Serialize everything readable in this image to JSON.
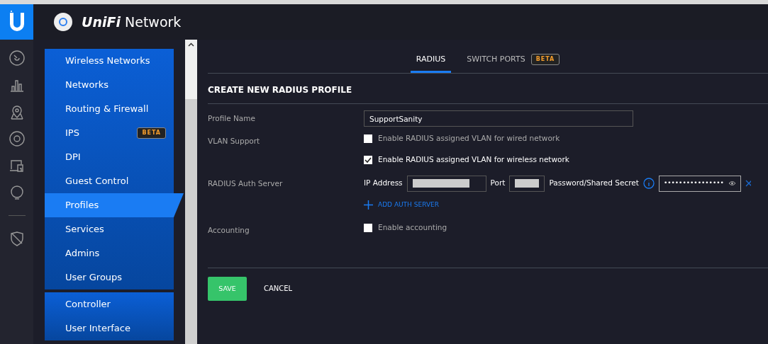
{
  "header": {
    "brand_italic": "UniFi",
    "brand": "Network"
  },
  "rail": [
    {
      "kind": "dashboard"
    },
    {
      "kind": "stats"
    },
    {
      "kind": "map"
    },
    {
      "kind": "devices"
    },
    {
      "kind": "clients"
    },
    {
      "kind": "insights"
    },
    {
      "kind": "divider"
    },
    {
      "kind": "shield"
    }
  ],
  "sidebar": {
    "groups": [
      {
        "items": [
          {
            "label": "Wireless Networks",
            "selected": false
          },
          {
            "label": "Networks",
            "selected": false
          },
          {
            "label": "Routing & Firewall",
            "selected": false
          },
          {
            "label": "IPS",
            "selected": false,
            "badge": "BETA"
          },
          {
            "label": "DPI",
            "selected": false
          },
          {
            "label": "Guest Control",
            "selected": false
          },
          {
            "label": "Profiles",
            "selected": true
          },
          {
            "label": "Services",
            "selected": false
          },
          {
            "label": "Admins",
            "selected": false
          },
          {
            "label": "User Groups",
            "selected": false
          }
        ]
      },
      {
        "items": [
          {
            "label": "Controller",
            "selected": false
          },
          {
            "label": "User Interface",
            "selected": false
          }
        ]
      }
    ]
  },
  "tabs": [
    {
      "label": "RADIUS",
      "selected": true
    },
    {
      "label": "SWITCH PORTS",
      "selected": false,
      "badge": "BETA"
    }
  ],
  "form": {
    "title": "CREATE NEW RADIUS PROFILE",
    "profile_name": {
      "label": "Profile Name",
      "value": "SupportSanity"
    },
    "vlan": {
      "label": "VLAN Support",
      "options": [
        {
          "label": "Enable RADIUS assigned VLAN for wired network",
          "checked": false
        },
        {
          "label": "Enable RADIUS assigned VLAN for wireless network",
          "checked": true
        }
      ]
    },
    "auth": {
      "label": "RADIUS Auth Server",
      "ip_label": "IP Address",
      "port_label": "Port",
      "secret_label": "Password/Shared Secret",
      "secret_mask": "••••••••••••••••",
      "add_label": "ADD AUTH SERVER"
    },
    "accounting": {
      "label": "Accounting",
      "option": {
        "label": "Enable accounting",
        "checked": false
      }
    },
    "buttons": [
      {
        "label": "SAVE",
        "kind": "primary"
      },
      {
        "label": "CANCEL",
        "kind": "link"
      }
    ]
  }
}
